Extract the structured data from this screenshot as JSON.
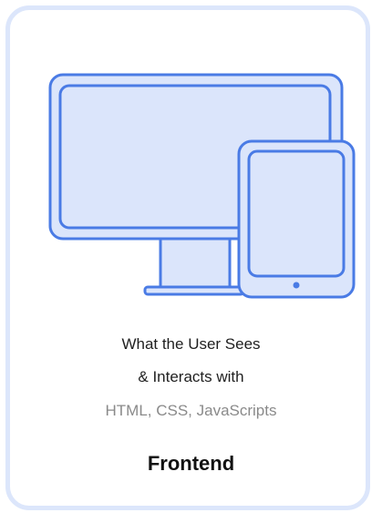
{
  "card": {
    "description_line1": "What the User Sees",
    "description_line2": "& Interacts with",
    "technologies": "HTML, CSS, JavaScripts",
    "title": "Frontend"
  },
  "colors": {
    "card_border": "#dce6fb",
    "icon_stroke": "#4a7be5",
    "icon_fill": "#dbe5fb",
    "primary_text": "#1f1f1f",
    "secondary_text": "#8a8a8a"
  },
  "icons": [
    "desktop-monitor-icon",
    "tablet-icon"
  ]
}
